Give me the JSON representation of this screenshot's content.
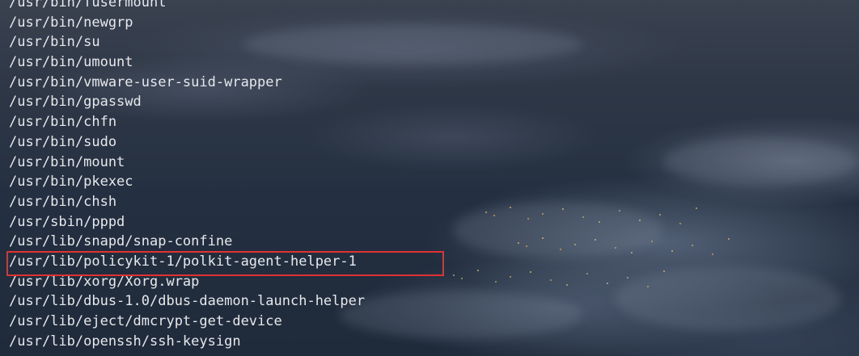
{
  "terminal": {
    "lines": [
      "/usr/bin/fusermount",
      "/usr/bin/newgrp",
      "/usr/bin/su",
      "/usr/bin/umount",
      "/usr/bin/vmware-user-suid-wrapper",
      "/usr/bin/gpasswd",
      "/usr/bin/chfn",
      "/usr/bin/sudo",
      "/usr/bin/mount",
      "/usr/bin/pkexec",
      "/usr/bin/chsh",
      "/usr/sbin/pppd",
      "/usr/lib/snapd/snap-confine",
      "/usr/lib/policykit-1/polkit-agent-helper-1",
      "/usr/lib/xorg/Xorg.wrap",
      "/usr/lib/dbus-1.0/dbus-daemon-launch-helper",
      "/usr/lib/eject/dmcrypt-get-device",
      "/usr/lib/openssh/ssh-keysign"
    ],
    "highlighted_line_index": 13
  },
  "colors": {
    "text": "#e6e8ec",
    "highlight_border": "#e03232"
  }
}
